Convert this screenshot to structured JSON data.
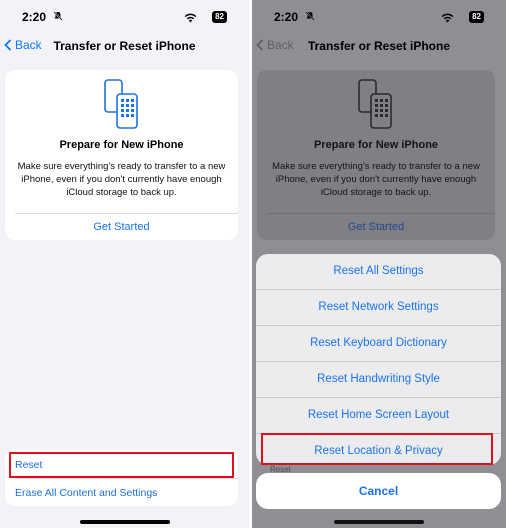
{
  "status": {
    "time": "2:20",
    "battery": "82"
  },
  "nav": {
    "back_label": "Back",
    "title": "Transfer or Reset iPhone"
  },
  "prepare": {
    "heading": "Prepare for New iPhone",
    "body": "Make sure everything's ready to transfer to a new iPhone, even if you don't currently have enough iCloud storage to back up.",
    "cta": "Get Started"
  },
  "reset_group": {
    "reset_label": "Reset",
    "erase_label": "Erase All Content and Settings"
  },
  "sheet": {
    "options": [
      "Reset All Settings",
      "Reset Network Settings",
      "Reset Keyboard Dictionary",
      "Reset Handwriting Style",
      "Reset Home Screen Layout",
      "Reset Location & Privacy"
    ],
    "cancel_label": "Cancel",
    "peek_label": "Reset"
  },
  "colors": {
    "accent": "#1a73e8",
    "highlight": "#e0101b",
    "background": "#f2f2f7"
  },
  "icons": [
    "bell-slash-icon",
    "wifi-icon",
    "battery-icon",
    "chevron-left-icon",
    "two-phones-icon"
  ]
}
